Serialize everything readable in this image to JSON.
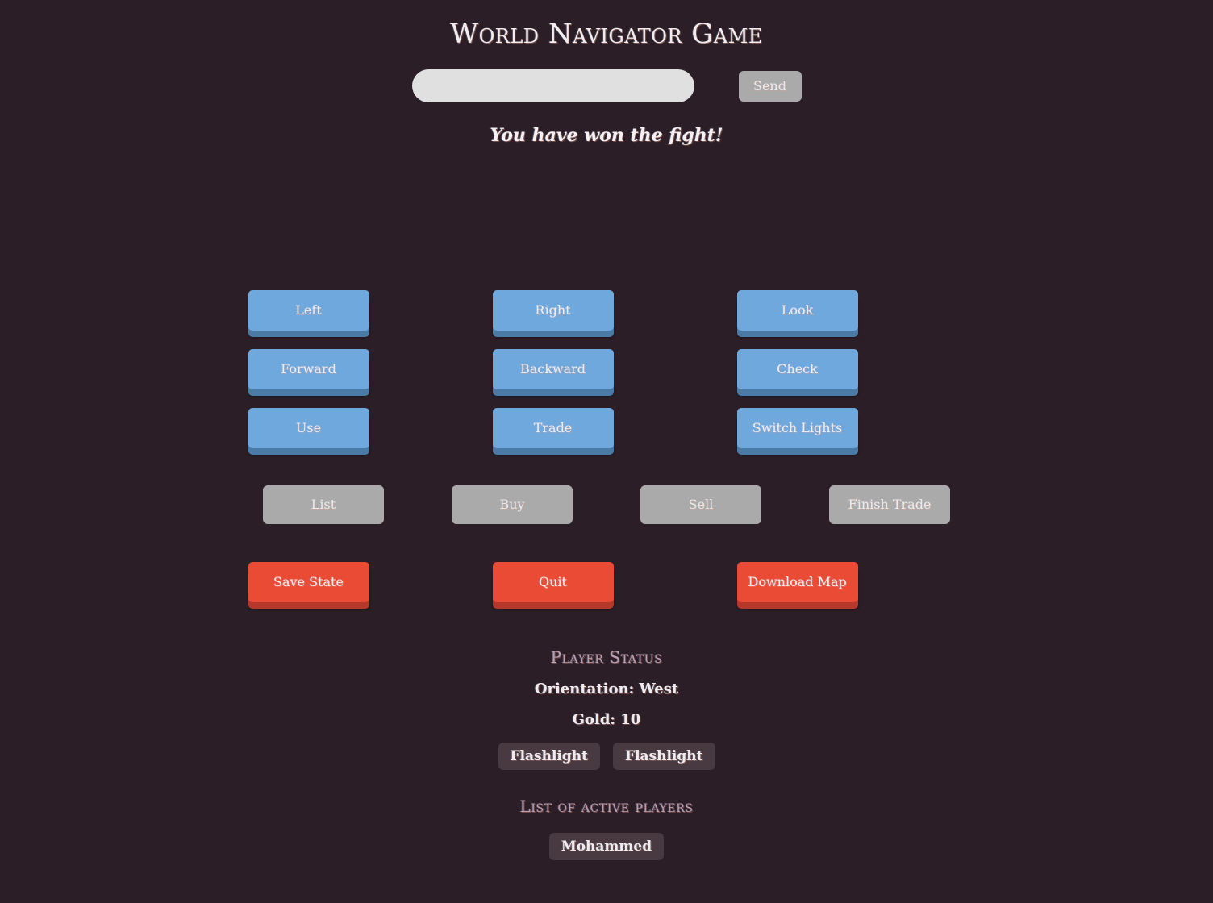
{
  "app": {
    "title": "World Navigator Game",
    "background_color": "#2c1e26"
  },
  "command_bar": {
    "input_value": "",
    "input_placeholder": "",
    "send_label": "Send"
  },
  "message": {
    "text": "You have won the fight!"
  },
  "colors": {
    "blue_button": "#6fa8dc",
    "blue_button_shadow": "#4a7ba7",
    "red_button": "#e94b35",
    "red_button_shadow": "#b4392a",
    "disabled_button": "#aaaaaa",
    "heading_accent": "#b89fb4",
    "chip_background": "#493a42"
  },
  "actions": {
    "nav_rows": [
      [
        {
          "label": "Left",
          "state": "enabled"
        },
        {
          "label": "Right",
          "state": "enabled"
        },
        {
          "label": "Look",
          "state": "enabled"
        }
      ],
      [
        {
          "label": "Forward",
          "state": "enabled"
        },
        {
          "label": "Backward",
          "state": "enabled"
        },
        {
          "label": "Check",
          "state": "enabled"
        }
      ],
      [
        {
          "label": "Use",
          "state": "enabled"
        },
        {
          "label": "Trade",
          "state": "enabled"
        },
        {
          "label": "Switch Lights",
          "state": "enabled"
        }
      ]
    ],
    "trade_row": [
      {
        "label": "List",
        "state": "disabled"
      },
      {
        "label": "Buy",
        "state": "disabled"
      },
      {
        "label": "Sell",
        "state": "disabled"
      },
      {
        "label": "Finish Trade",
        "state": "disabled"
      }
    ],
    "system_row": [
      {
        "label": "Save State",
        "state": "enabled"
      },
      {
        "label": "Quit",
        "state": "enabled"
      },
      {
        "label": "Download Map",
        "state": "enabled"
      }
    ]
  },
  "player_status": {
    "heading": "Player Status",
    "orientation_line": "Orientation: West",
    "gold_line": "Gold: 10",
    "inventory": [
      {
        "label": "Flashlight"
      },
      {
        "label": "Flashlight"
      }
    ]
  },
  "players": {
    "heading": "List of active players",
    "items": [
      {
        "label": "Mohammed"
      }
    ]
  }
}
